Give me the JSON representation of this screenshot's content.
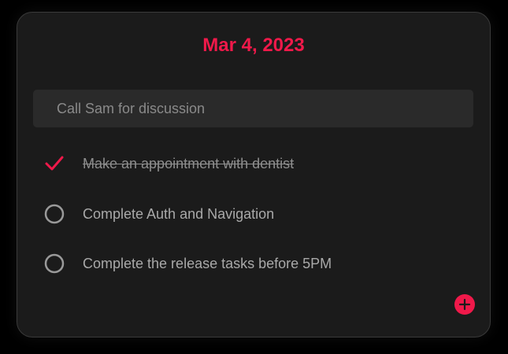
{
  "header": {
    "date": "Mar 4, 2023"
  },
  "new_task": {
    "placeholder": "Call Sam for discussion",
    "value": ""
  },
  "tasks": [
    {
      "label": "Make an appointment with dentist",
      "done": true
    },
    {
      "label": "Complete Auth and Navigation",
      "done": false
    },
    {
      "label": "Complete the release tasks before 5PM",
      "done": false
    }
  ],
  "icons": {
    "done": "check-icon",
    "pending": "circle-icon",
    "add": "plus-icon"
  },
  "colors": {
    "accent": "#f0194a",
    "card_background": "#1b1b1b",
    "input_background": "#2a2a2a",
    "text": "#a9a9a9"
  }
}
